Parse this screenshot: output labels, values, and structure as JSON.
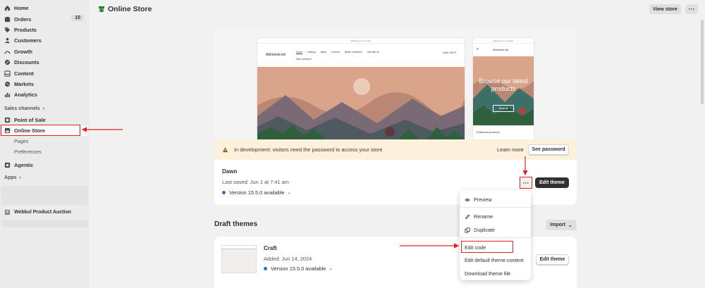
{
  "sidebar": {
    "items": [
      {
        "label": "Home",
        "icon": "home-icon"
      },
      {
        "label": "Orders",
        "icon": "orders-icon",
        "badge": "10"
      },
      {
        "label": "Products",
        "icon": "tag-icon"
      },
      {
        "label": "Customers",
        "icon": "person-icon"
      },
      {
        "label": "Growth",
        "icon": "growth-icon"
      },
      {
        "label": "Discounts",
        "icon": "discount-icon"
      },
      {
        "label": "Content",
        "icon": "content-icon"
      },
      {
        "label": "Markets",
        "icon": "globe-icon"
      },
      {
        "label": "Analytics",
        "icon": "analytics-icon"
      }
    ],
    "sales_channels_label": "Sales channels",
    "channels": [
      {
        "label": "Point of Sale",
        "icon": "pos-icon"
      },
      {
        "label": "Online Store",
        "icon": "store-icon"
      }
    ],
    "online_store_sub": [
      "Pages",
      "Preferences"
    ],
    "agentic_label": "Agentic",
    "apps_label": "Apps",
    "app_item_label": "Webkul Product Auction"
  },
  "header": {
    "title": "Online Store",
    "view_store": "View store",
    "more": "···"
  },
  "preview": {
    "desktop_bar": "Welcome to our store",
    "desktop_logo": "Abhishek-bd",
    "desktop_menu": [
      "Home",
      "Catalog",
      "Alpha",
      "Contact",
      "Better Collection",
      "Sell with us"
    ],
    "desktop_menu2": "New collection",
    "desktop_right": "India | INR ₹",
    "mobile_bar": "Welcome to our store",
    "mobile_logo": "Abhishek-bd",
    "mobile_hero_text": "Browse our latest products",
    "mobile_hero_btn": "Shop all",
    "mobile_featured": "Featured products"
  },
  "dev_banner": {
    "text": "In development: visitors need the password to access your store",
    "learn_more": "Learn more",
    "see_password": "See password"
  },
  "current_theme": {
    "name": "Dawn",
    "saved": "Last saved: Jun 1 at 7:41 am",
    "version": "Version 15.5.0 available",
    "edit_theme": "Edit theme",
    "dots": "···"
  },
  "dropdown": {
    "preview": "Preview",
    "rename": "Rename",
    "duplicate": "Duplicate",
    "edit_code": "Edit code",
    "edit_default": "Edit default theme content",
    "download": "Download theme file"
  },
  "draft": {
    "title": "Draft themes",
    "import": "Import",
    "theme_name": "Craft",
    "added": "Added: Jun 14, 2024",
    "version": "Version 15.5.0 available",
    "edit_theme": "Edit theme"
  },
  "colors": {
    "annotation_red": "#e02424",
    "version_dot": "#2c6ecb",
    "primary_button": "#303030",
    "banner_bg": "#fdf1de"
  }
}
